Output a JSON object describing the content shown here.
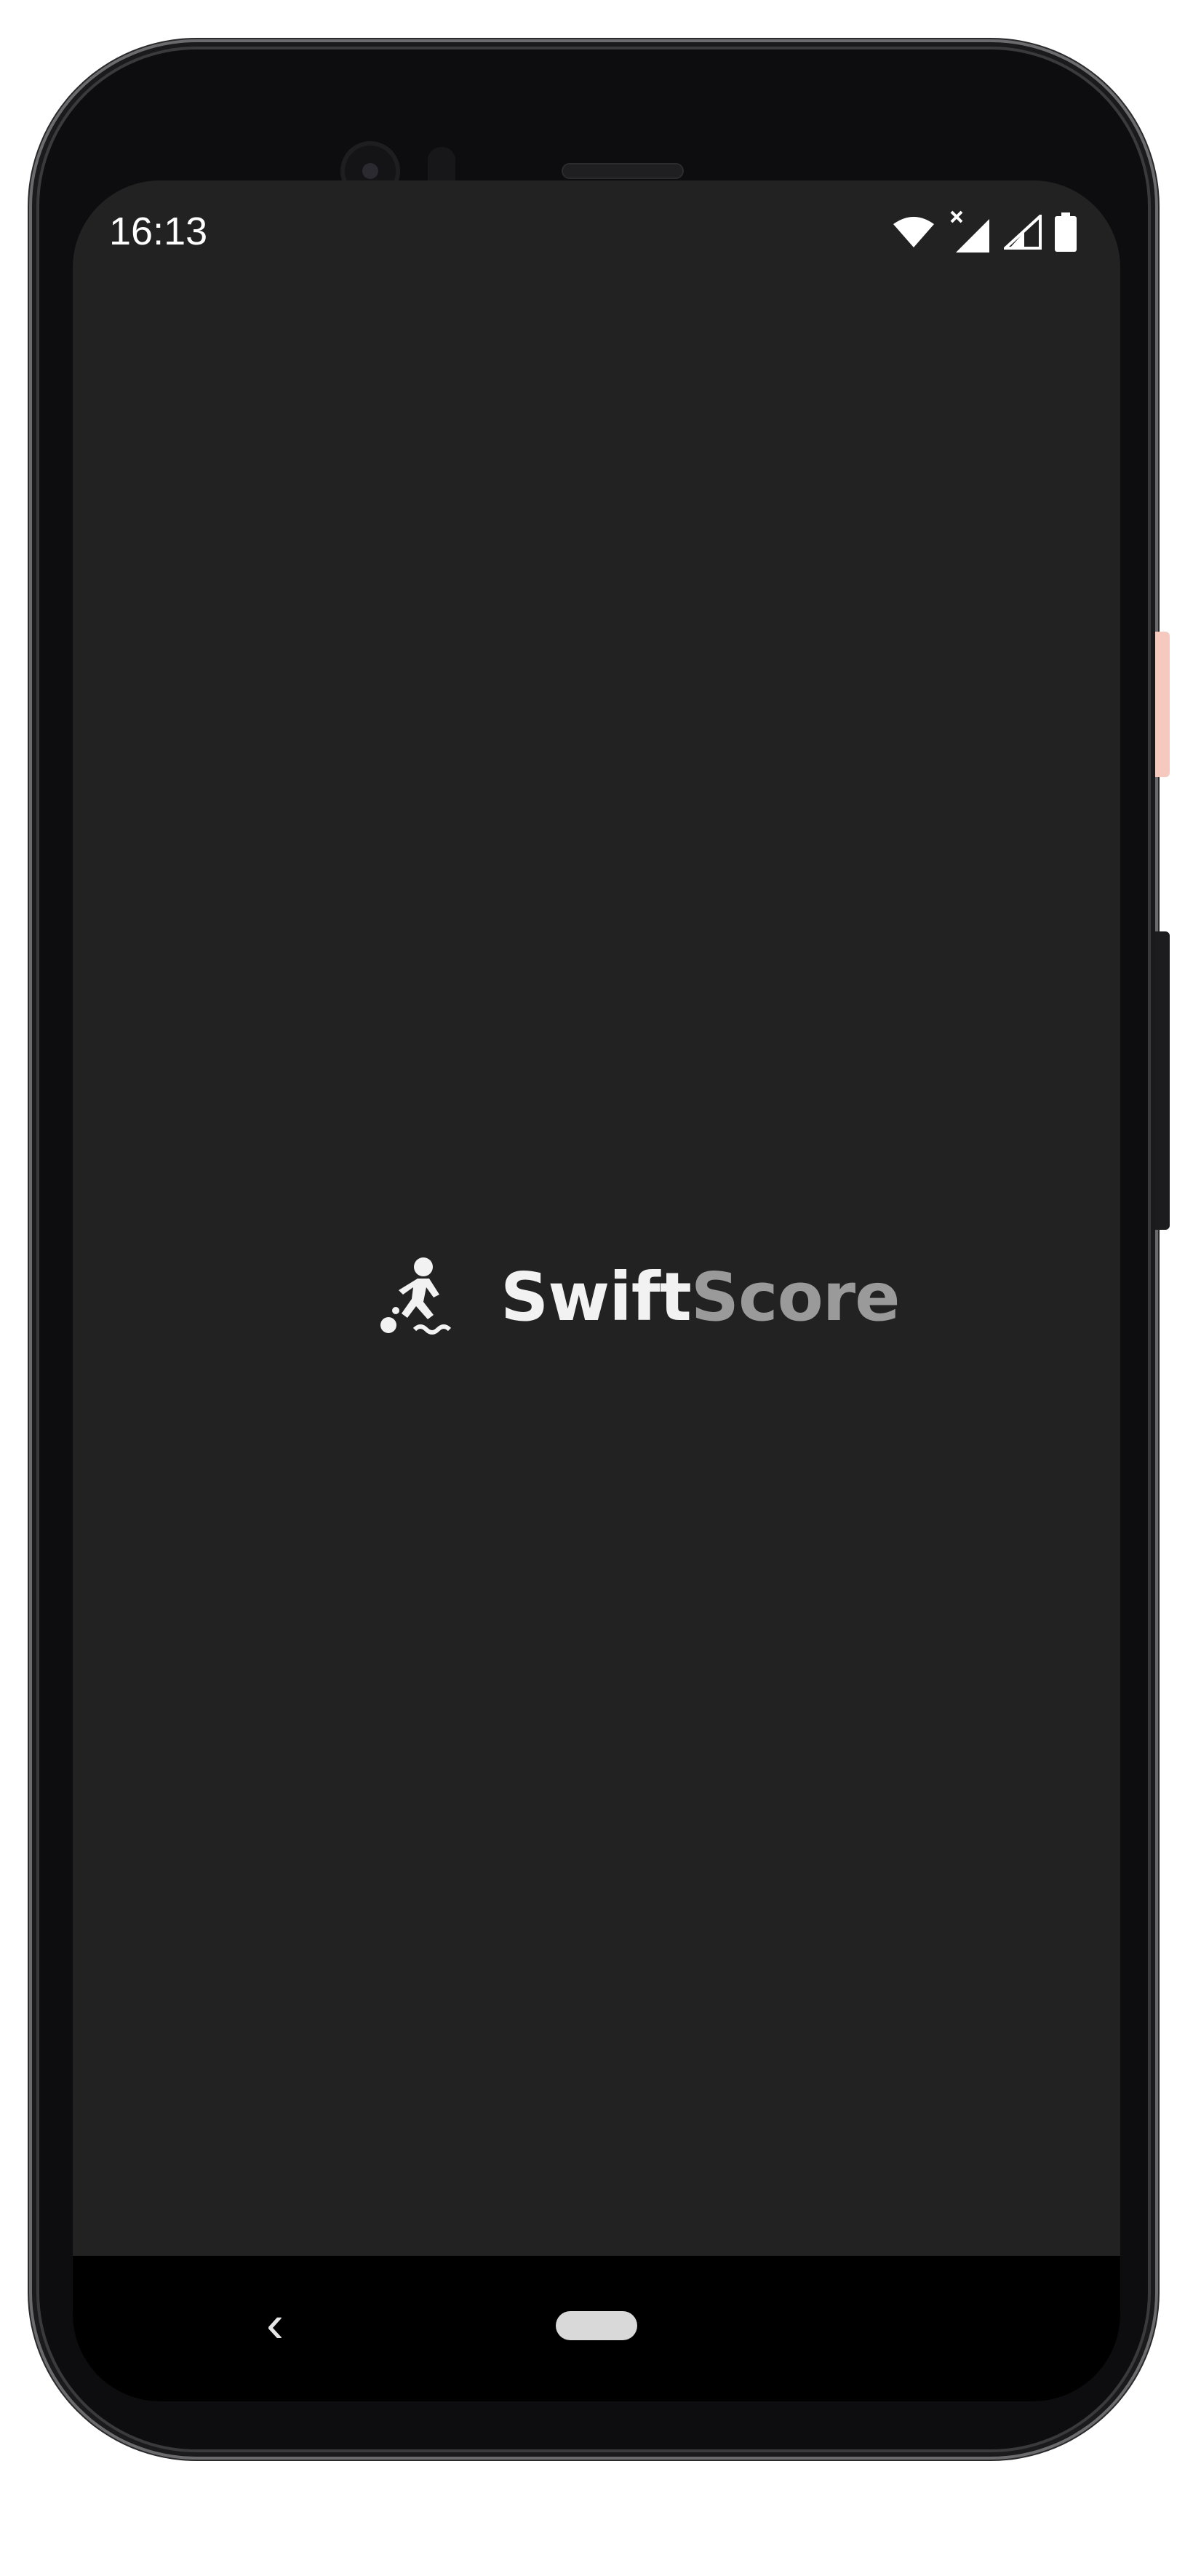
{
  "status_bar": {
    "time": "16:13",
    "icons": [
      "wifi-icon",
      "cellular-no-data-icon",
      "cellular-signal-icon",
      "battery-icon"
    ]
  },
  "splash": {
    "app_name_part1": "Swift",
    "app_name_part2": "Score",
    "logo_icon": "soccer-player-icon",
    "colors": {
      "background": "#222222",
      "name_primary": "#f2f2f2",
      "name_secondary": "#9a9a9a"
    }
  },
  "nav_bar": {
    "back_icon": "back-chevron-icon",
    "home_icon": "home-pill-icon",
    "back_glyph": "‹"
  }
}
